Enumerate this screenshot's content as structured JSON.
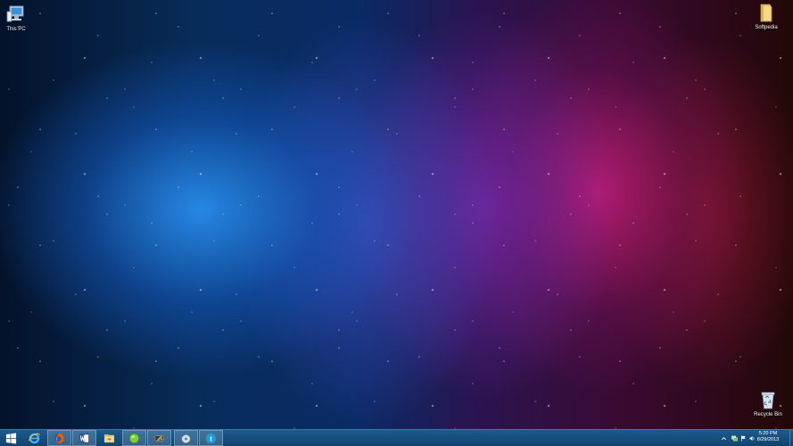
{
  "desktop": {
    "icons": [
      {
        "label": "This PC",
        "icon": "this-pc-icon"
      },
      {
        "label": "Softpedia",
        "icon": "folder-icon"
      },
      {
        "label": "Recycle Bin",
        "icon": "recycle-bin-icon"
      }
    ]
  },
  "taskbar": {
    "buttons": [
      {
        "icon": "windows-start-icon"
      },
      {
        "icon": "internet-explorer-icon"
      },
      {
        "icon": "firefox-icon"
      },
      {
        "icon": "word-icon"
      },
      {
        "icon": "file-explorer-icon"
      },
      {
        "icon": "green-ball-app-icon"
      },
      {
        "icon": "tool-app-icon"
      },
      {
        "icon": "disc-app-icon"
      },
      {
        "icon": "skype-icon"
      }
    ],
    "tray": {
      "icons": [
        "tray-overflow-chevron-icon",
        "network-icon",
        "action-center-flag-icon",
        "volume-icon"
      ],
      "time": "5:20 PM",
      "date": "8/29/2013"
    }
  },
  "colors": {
    "taskbar": "#174f7d",
    "skype": "#1a9fdc",
    "word": "#2b5797",
    "firefox": "#e66000"
  }
}
